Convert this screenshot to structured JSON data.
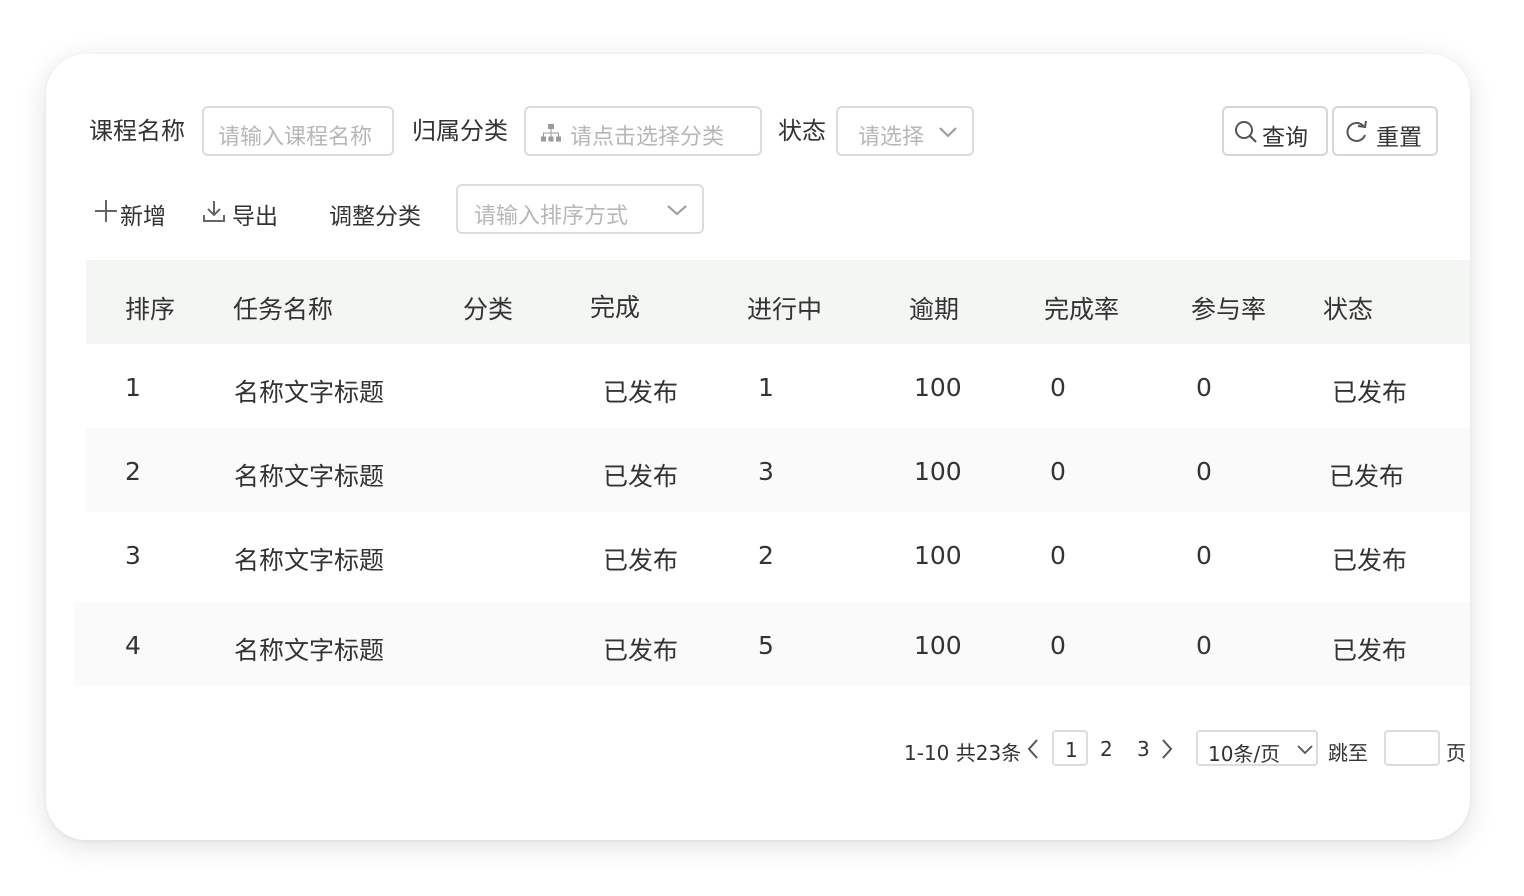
{
  "filters": {
    "course_name_label": "课程名称",
    "course_name_placeholder": "请输入课程名称",
    "category_label": "归属分类",
    "category_placeholder": "请点击选择分类",
    "status_label": "状态",
    "status_placeholder": "请选择",
    "query_button": "查询",
    "reset_button": "重置"
  },
  "toolbar": {
    "add_label": "新增",
    "export_label": "导出",
    "adjust_category_label": "调整分类",
    "sort_placeholder": "请输入排序方式"
  },
  "table": {
    "headers": [
      "排序",
      "任务名称",
      "分类",
      "完成",
      "进行中",
      "逾期",
      "完成率",
      "参与率",
      "状态"
    ],
    "rows": [
      {
        "order": "1",
        "name": "名称文字标题",
        "category": "",
        "done": "已发布",
        "in_progress": "1",
        "overdue": "100",
        "completion_rate": "0",
        "participation_rate": "0",
        "status": "已发布"
      },
      {
        "order": "2",
        "name": "名称文字标题",
        "category": "",
        "done": "已发布",
        "in_progress": "3",
        "overdue": "100",
        "completion_rate": "0",
        "participation_rate": "0",
        "status": "已发布"
      },
      {
        "order": "3",
        "name": "名称文字标题",
        "category": "",
        "done": "已发布",
        "in_progress": "2",
        "overdue": "100",
        "completion_rate": "0",
        "participation_rate": "0",
        "status": "已发布"
      },
      {
        "order": "4",
        "name": "名称文字标题",
        "category": "",
        "done": "已发布",
        "in_progress": "5",
        "overdue": "100",
        "completion_rate": "0",
        "participation_rate": "0",
        "status": "已发布"
      }
    ]
  },
  "pagination": {
    "range_text": "1-10 共23条",
    "pages": [
      "1",
      "2",
      "3"
    ],
    "current_page": "1",
    "page_size": "10条/页",
    "jump_label": "跳至",
    "page_suffix": "页"
  },
  "icons": {
    "category": "sitemap-icon",
    "dropdown": "chevron-down-icon",
    "query": "search-icon",
    "reset": "refresh-icon",
    "add": "plus-icon",
    "export": "download-icon",
    "prev": "chevron-left-icon",
    "next": "chevron-right-icon"
  },
  "colors": {
    "header_bg": "#f4f6f3",
    "alt_row_bg": "#fafafa",
    "border": "#dcdcdc",
    "placeholder": "#b7b7b7"
  }
}
